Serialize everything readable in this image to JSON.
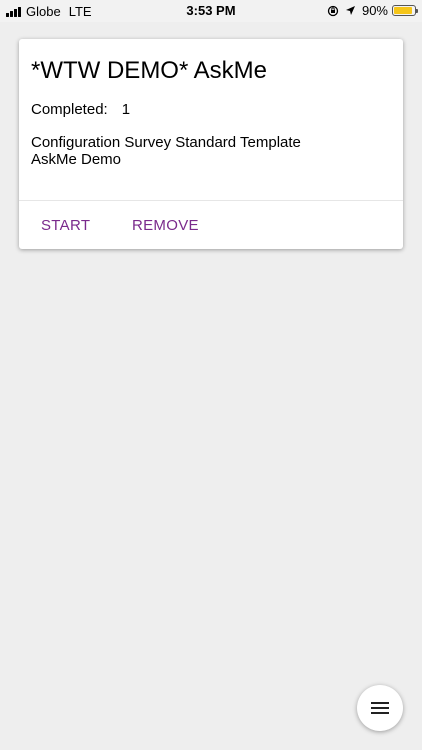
{
  "status_bar": {
    "carrier": "Globe",
    "network": "LTE",
    "time": "3:53 PM",
    "battery": "90%",
    "battery_level": 0.9
  },
  "survey_card": {
    "title": "*WTW DEMO* AskMe",
    "completed_label": "Completed:",
    "completed_value": "1",
    "description_line1": "Configuration Survey Standard Template",
    "description_line2": "AskMe Demo",
    "start_label": "START",
    "remove_label": "REMOVE",
    "accent_color": "#7a2a8c"
  },
  "fab": {
    "icon": "menu-icon"
  }
}
